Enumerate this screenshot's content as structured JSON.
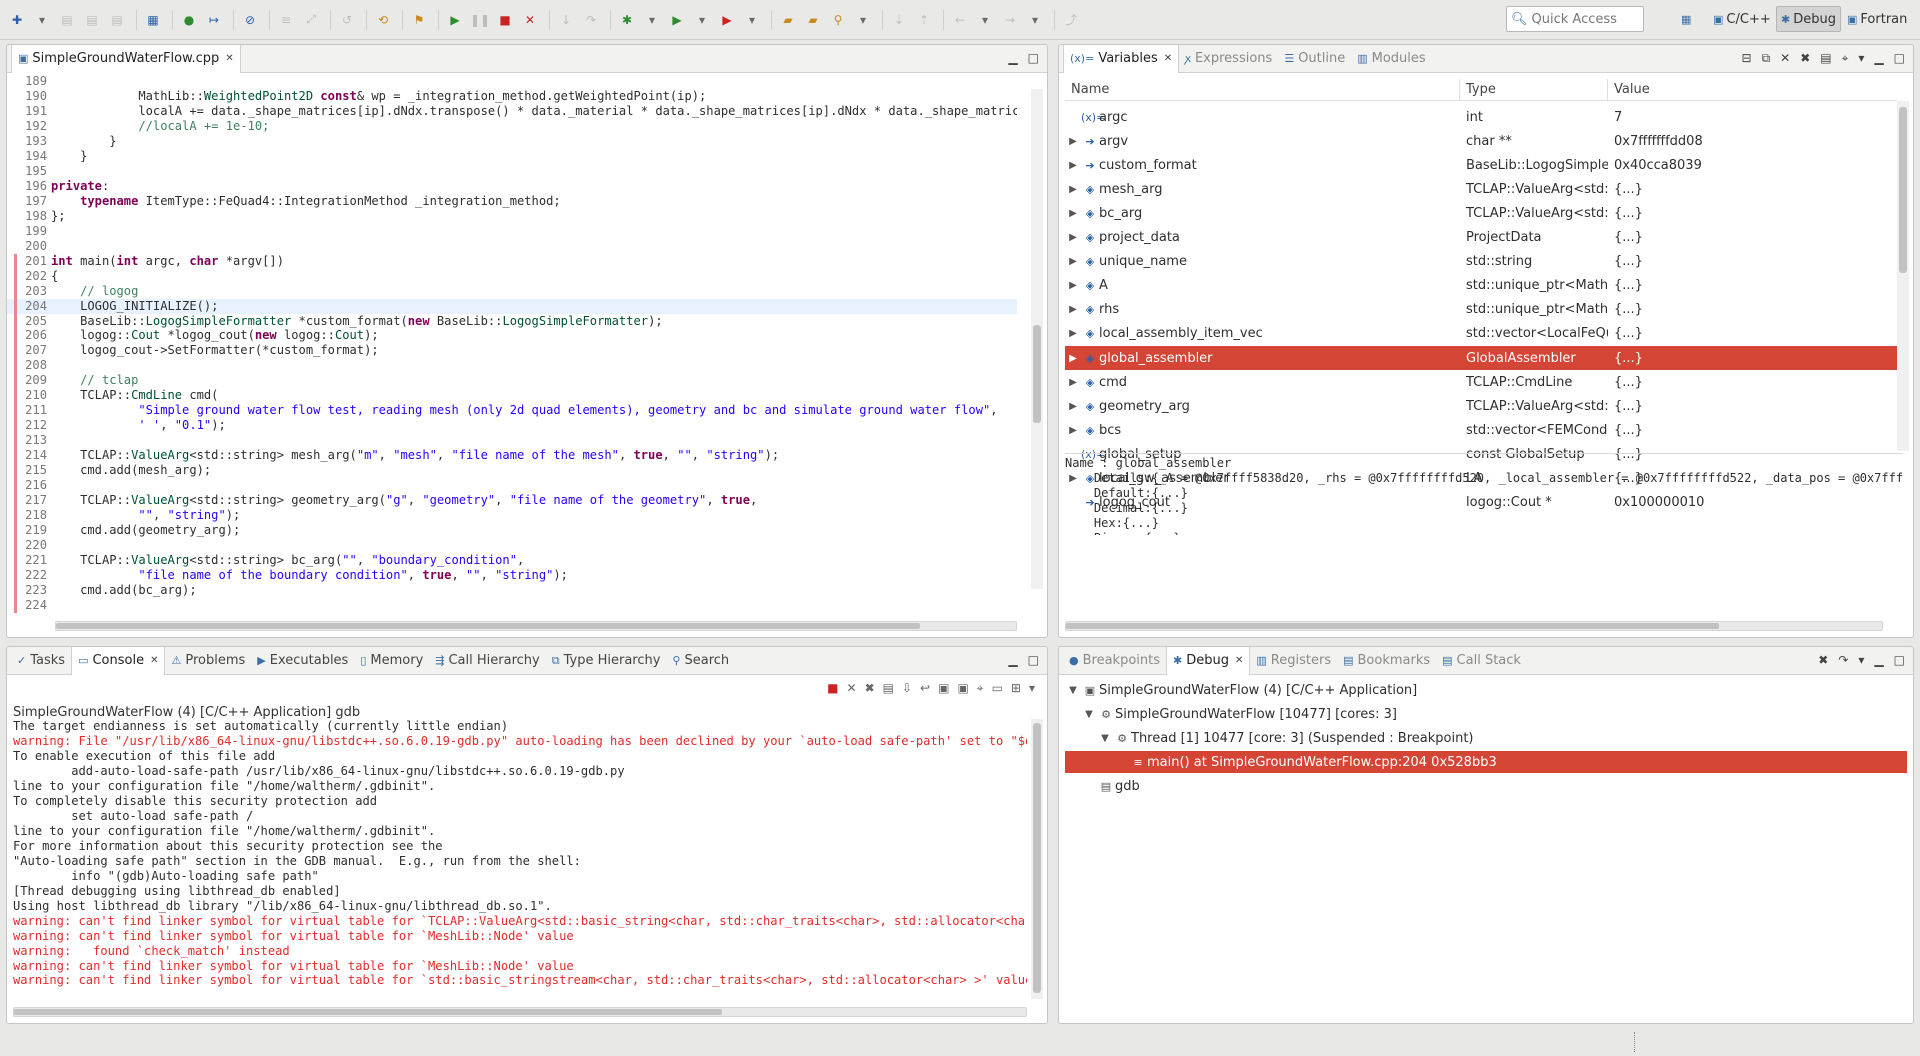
{
  "search": {
    "label": "Quick Access"
  },
  "perspectives": [
    "C/C++",
    "Debug",
    "Fortran"
  ],
  "editor": {
    "tab_title": "SimpleGroundWaterFlow.cpp",
    "lines": [
      {
        "n": "189",
        "parts": []
      },
      {
        "n": "190",
        "parts": [
          [
            "",
            "            MathLib::"
          ],
          [
            "ty",
            "WeightedPoint2D"
          ],
          [
            "kw",
            " const"
          ],
          [
            "",
            "& wp = _integration_method.getWeightedPoint(ip);"
          ]
        ]
      },
      {
        "n": "191",
        "parts": [
          [
            "",
            "            localA += data._shape_matrices[ip].dNdx.transpose() * data._material * data._shape_matrices[ip].dNdx * data._shape_matrices[ip"
          ]
        ]
      },
      {
        "n": "192",
        "parts": [
          [
            "cm",
            "            //localA += 1e-10;"
          ]
        ]
      },
      {
        "n": "193",
        "parts": [
          [
            "",
            "        }"
          ]
        ]
      },
      {
        "n": "194",
        "parts": [
          [
            "",
            "    }"
          ]
        ]
      },
      {
        "n": "195",
        "parts": []
      },
      {
        "n": "196",
        "parts": [
          [
            "kw",
            "private"
          ],
          [
            "",
            ":"
          ]
        ]
      },
      {
        "n": "197",
        "parts": [
          [
            "kw",
            "    typename"
          ],
          [
            "",
            " ItemType::FeQuad4::IntegrationMethod _integration_method;"
          ]
        ]
      },
      {
        "n": "198",
        "parts": [
          [
            "",
            "};"
          ]
        ]
      },
      {
        "n": "199",
        "parts": []
      },
      {
        "n": "200",
        "parts": []
      },
      {
        "n": "201",
        "parts": [
          [
            "kw",
            "int"
          ],
          [
            "",
            " main("
          ],
          [
            "kw",
            "int"
          ],
          [
            "",
            " argc, "
          ],
          [
            "kw",
            "char"
          ],
          [
            "",
            " *argv[])"
          ]
        ]
      },
      {
        "n": "202",
        "parts": [
          [
            "",
            "{"
          ]
        ]
      },
      {
        "n": "203",
        "parts": [
          [
            "cm",
            "    // logog"
          ]
        ]
      },
      {
        "n": "204",
        "parts": [
          [
            "",
            "    LOGOG_INITIALIZE();"
          ]
        ],
        "hl": true
      },
      {
        "n": "205",
        "parts": [
          [
            "",
            "    BaseLib::"
          ],
          [
            "ty",
            "LogogSimpleFormatter"
          ],
          [
            "",
            " *custom_format("
          ],
          [
            "kw",
            "new"
          ],
          [
            "",
            " BaseLib::"
          ],
          [
            "ty",
            "LogogSimpleFormatter"
          ],
          [
            "",
            ");"
          ]
        ]
      },
      {
        "n": "206",
        "parts": [
          [
            "",
            "    logog::"
          ],
          [
            "ty",
            "Cout"
          ],
          [
            "",
            " *logog_cout("
          ],
          [
            "kw",
            "new"
          ],
          [
            "",
            " logog::"
          ],
          [
            "ty",
            "Cout"
          ],
          [
            "",
            ");"
          ]
        ]
      },
      {
        "n": "207",
        "parts": [
          [
            "",
            "    logog_cout->SetFormatter(*custom_format);"
          ]
        ]
      },
      {
        "n": "208",
        "parts": []
      },
      {
        "n": "209",
        "parts": [
          [
            "cm",
            "    // tclap"
          ]
        ]
      },
      {
        "n": "210",
        "parts": [
          [
            "",
            "    TCLAP::"
          ],
          [
            "ty",
            "CmdLine"
          ],
          [
            "",
            " cmd("
          ]
        ]
      },
      {
        "n": "211",
        "parts": [
          [
            "str",
            "            \"Simple ground water flow test, reading mesh (only 2d quad elements), geometry and bc and simulate ground water flow\""
          ],
          [
            "",
            ","
          ]
        ]
      },
      {
        "n": "212",
        "parts": [
          [
            "str",
            "            ' '"
          ],
          [
            "",
            ", "
          ],
          [
            "str",
            "\"0.1\""
          ],
          [
            "",
            ");"
          ]
        ]
      },
      {
        "n": "213",
        "parts": []
      },
      {
        "n": "214",
        "parts": [
          [
            "",
            "    TCLAP::"
          ],
          [
            "ty",
            "ValueArg"
          ],
          [
            "",
            "<std::string> mesh_arg("
          ],
          [
            "str",
            "\"m\""
          ],
          [
            "",
            ", "
          ],
          [
            "str",
            "\"mesh\""
          ],
          [
            "",
            ", "
          ],
          [
            "str",
            "\"file name of the mesh\""
          ],
          [
            "",
            ", "
          ],
          [
            "kw",
            "true"
          ],
          [
            "",
            ", "
          ],
          [
            "str",
            "\"\""
          ],
          [
            "",
            ", "
          ],
          [
            "str",
            "\"string\""
          ],
          [
            "",
            ");"
          ]
        ]
      },
      {
        "n": "215",
        "parts": [
          [
            "",
            "    cmd.add(mesh_arg);"
          ]
        ]
      },
      {
        "n": "216",
        "parts": []
      },
      {
        "n": "217",
        "parts": [
          [
            "",
            "    TCLAP::"
          ],
          [
            "ty",
            "ValueArg"
          ],
          [
            "",
            "<std::string> geometry_arg("
          ],
          [
            "str",
            "\"g\""
          ],
          [
            "",
            ", "
          ],
          [
            "str",
            "\"geometry\""
          ],
          [
            "",
            ", "
          ],
          [
            "str",
            "\"file name of the geometry\""
          ],
          [
            "",
            ", "
          ],
          [
            "kw",
            "true"
          ],
          [
            "",
            ","
          ]
        ]
      },
      {
        "n": "218",
        "parts": [
          [
            "str",
            "            \"\""
          ],
          [
            "",
            ", "
          ],
          [
            "str",
            "\"string\""
          ],
          [
            "",
            ");"
          ]
        ]
      },
      {
        "n": "219",
        "parts": [
          [
            "",
            "    cmd.add(geometry_arg);"
          ]
        ]
      },
      {
        "n": "220",
        "parts": []
      },
      {
        "n": "221",
        "parts": [
          [
            "",
            "    TCLAP::"
          ],
          [
            "ty",
            "ValueArg"
          ],
          [
            "",
            "<std::string> bc_arg("
          ],
          [
            "str",
            "\"\""
          ],
          [
            "",
            ", "
          ],
          [
            "str",
            "\"boundary_condition\""
          ],
          [
            "",
            ","
          ]
        ]
      },
      {
        "n": "222",
        "parts": [
          [
            "str",
            "            \"file name of the boundary condition\""
          ],
          [
            "",
            ", "
          ],
          [
            "kw",
            "true"
          ],
          [
            "",
            ", "
          ],
          [
            "str",
            "\"\""
          ],
          [
            "",
            ", "
          ],
          [
            "str",
            "\"string\""
          ],
          [
            "",
            ");"
          ]
        ]
      },
      {
        "n": "223",
        "parts": [
          [
            "",
            "    cmd.add(bc_arg);"
          ]
        ]
      },
      {
        "n": "224",
        "parts": []
      }
    ]
  },
  "variables": {
    "tabs": [
      "Variables",
      "Expressions",
      "Outline",
      "Modules"
    ],
    "columns": [
      "Name",
      "Type",
      "Value"
    ],
    "rows": [
      {
        "name": "argc",
        "type": "int",
        "value": "7",
        "expand": false,
        "icon": "(x)="
      },
      {
        "name": "argv",
        "type": "char **",
        "value": "0x7fffffffdd08",
        "expand": true,
        "icon": "➔"
      },
      {
        "name": "custom_format",
        "type": "BaseLib::LogogSimpleFo",
        "value": "0x40cca8039",
        "expand": true,
        "icon": "➔"
      },
      {
        "name": "mesh_arg",
        "type": "TCLAP::ValueArg<std::b",
        "value": "{...}",
        "expand": true,
        "icon": "◈"
      },
      {
        "name": "bc_arg",
        "type": "TCLAP::ValueArg<std::b",
        "value": "{...}",
        "expand": true,
        "icon": "◈"
      },
      {
        "name": "project_data",
        "type": "ProjectData",
        "value": "{...}",
        "expand": true,
        "icon": "◈"
      },
      {
        "name": "unique_name",
        "type": "std::string",
        "value": "{...}",
        "expand": true,
        "icon": "◈"
      },
      {
        "name": "A",
        "type": "std::unique_ptr<MathLib",
        "value": "{...}",
        "expand": true,
        "icon": "◈"
      },
      {
        "name": "rhs",
        "type": "std::unique_ptr<MathLib",
        "value": "{...}",
        "expand": true,
        "icon": "◈"
      },
      {
        "name": "local_assembly_item_vec",
        "type": "std::vector<LocalFeQua",
        "value": "{...}",
        "expand": true,
        "icon": "◈"
      },
      {
        "name": "global_assembler",
        "type": "GlobalAssembler",
        "value": "{...}",
        "expand": true,
        "icon": "◈",
        "sel": true
      },
      {
        "name": "cmd",
        "type": "TCLAP::CmdLine",
        "value": "{...}",
        "expand": true,
        "icon": "◈"
      },
      {
        "name": "geometry_arg",
        "type": "TCLAP::ValueArg<std::b",
        "value": "{...}",
        "expand": true,
        "icon": "◈"
      },
      {
        "name": "bcs",
        "type": "std::vector<FEMConditic",
        "value": "{...}",
        "expand": true,
        "icon": "◈"
      },
      {
        "name": "global_setup",
        "type": "const GlobalSetup",
        "value": "{...}",
        "expand": false,
        "icon": "(x)="
      },
      {
        "name": "local_gw_assembler",
        "type": "LA",
        "value": "{...}",
        "expand": true,
        "icon": "◈"
      },
      {
        "name": "logog_cout",
        "type": "logog::Cout *",
        "value": "0x100000010",
        "expand": false,
        "icon": "➔"
      }
    ],
    "detail": [
      "Name : global_assembler",
      "    Details:{_A = @0x7ffff5838d20, _rhs = @0x7ffffffffd520, _local_assembler = @0x7ffffffffd522, _data_pos = @0x7ffff7df",
      "    Default:{...}",
      "    Decimal:{...}",
      "    Hex:{...}",
      "    Binary:{...}"
    ]
  },
  "console": {
    "tabs": [
      "Tasks",
      "Console",
      "Problems",
      "Executables",
      "Memory",
      "Call Hierarchy",
      "Type Hierarchy",
      "Search"
    ],
    "header": "SimpleGroundWaterFlow (4) [C/C++ Application] gdb",
    "lines": [
      {
        "t": "The target endianness is set automatically (currently little endian)",
        "w": false
      },
      {
        "t": "warning: File \"/usr/lib/x86_64-linux-gnu/libstdc++.so.6.0.19-gdb.py\" auto-loading has been declined by your `auto-load safe-path' set to \"$debugd",
        "w": true
      },
      {
        "t": "To enable execution of this file add",
        "w": false
      },
      {
        "t": "        add-auto-load-safe-path /usr/lib/x86_64-linux-gnu/libstdc++.so.6.0.19-gdb.py",
        "w": false
      },
      {
        "t": "line to your configuration file \"/home/waltherm/.gdbinit\".",
        "w": false
      },
      {
        "t": "To completely disable this security protection add",
        "w": false
      },
      {
        "t": "        set auto-load safe-path /",
        "w": false
      },
      {
        "t": "line to your configuration file \"/home/waltherm/.gdbinit\".",
        "w": false
      },
      {
        "t": "For more information about this security protection see the",
        "w": false
      },
      {
        "t": "\"Auto-loading safe path\" section in the GDB manual.  E.g., run from the shell:",
        "w": false
      },
      {
        "t": "        info \"(gdb)Auto-loading safe path\"",
        "w": false
      },
      {
        "t": "[Thread debugging using libthread_db enabled]",
        "w": false
      },
      {
        "t": "Using host libthread_db library \"/lib/x86_64-linux-gnu/libthread_db.so.1\".",
        "w": false
      },
      {
        "t": "warning: can't find linker symbol for virtual table for `TCLAP::ValueArg<std::basic_string<char, std::char_traits<char>, std::allocator<char> > >",
        "w": true
      },
      {
        "t": "warning: can't find linker symbol for virtual table for `MeshLib::Node' value",
        "w": true
      },
      {
        "t": "warning:   found `check_match' instead",
        "w": true
      },
      {
        "t": "warning: can't find linker symbol for virtual table for `MeshLib::Node' value",
        "w": true
      },
      {
        "t": "warning: can't find linker symbol for virtual table for `std::basic_stringstream<char, std::char_traits<char>, std::allocator<char> >' value",
        "w": true
      }
    ]
  },
  "debug": {
    "tabs": [
      "Breakpoints",
      "Debug",
      "Registers",
      "Bookmarks",
      "Call Stack"
    ],
    "tree": [
      {
        "label": "SimpleGroundWaterFlow (4) [C/C++ Application]",
        "indent": 0,
        "expand": "▼",
        "icon": "▣"
      },
      {
        "label": "SimpleGroundWaterFlow [10477] [cores: 3]",
        "indent": 1,
        "expand": "▼",
        "icon": "⚙"
      },
      {
        "label": "Thread [1] 10477 [core: 3] (Suspended : Breakpoint)",
        "indent": 2,
        "expand": "▼",
        "icon": "⚙"
      },
      {
        "label": "main() at SimpleGroundWaterFlow.cpp:204 0x528bb3",
        "indent": 3,
        "expand": "",
        "icon": "≡",
        "sel": true
      },
      {
        "label": "gdb",
        "indent": 1,
        "expand": "",
        "icon": "▤"
      }
    ]
  }
}
